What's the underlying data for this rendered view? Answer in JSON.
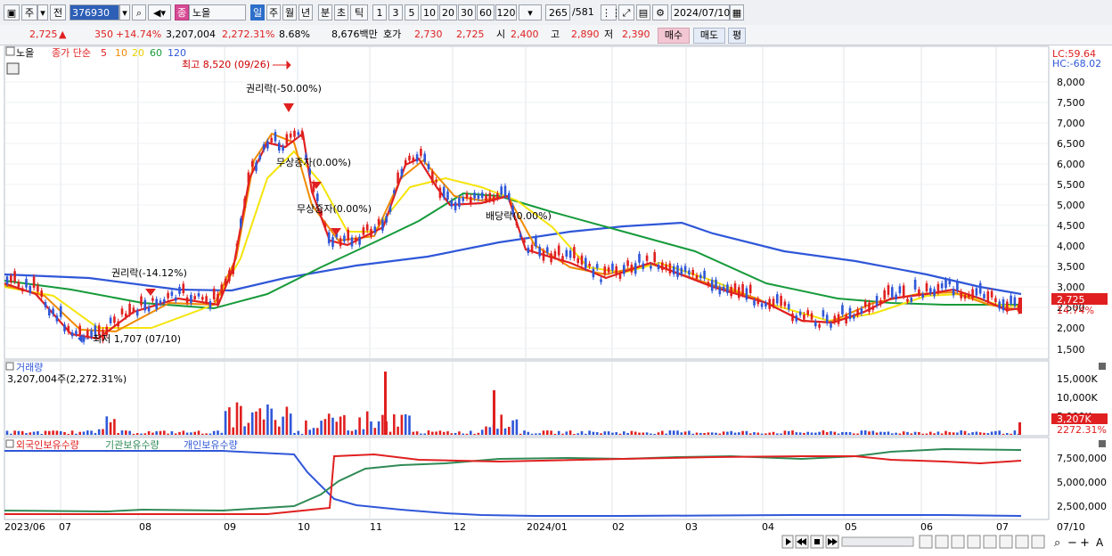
{
  "toolbar": {
    "type1": "주",
    "type2": "전",
    "code": "376930",
    "stock_name": "노을",
    "period_tabs": [
      "일",
      "주",
      "월",
      "년",
      "분",
      "초",
      "틱"
    ],
    "selected_period": "일",
    "minute_buttons": [
      "1",
      "3",
      "5",
      "10",
      "20",
      "30",
      "60",
      "120"
    ],
    "count_current": "265",
    "count_total": "/581",
    "date": "2024/07/10"
  },
  "info": {
    "price": "2,725",
    "change": "350",
    "change_pct": "+14.74%",
    "volume": "3,207,004",
    "volume_ratio": "2,272.31%",
    "turnover": "8.68%",
    "amount": "8,676백만",
    "ask_label": "호가",
    "ask1": "2,730",
    "ask2": "2,725",
    "open_label": "시",
    "open": "2,400",
    "high_label": "고",
    "high": "2,890",
    "low_label": "저",
    "low": "2,390",
    "buy_label": "매수",
    "sell_label": "매도",
    "avg_label": "평"
  },
  "price_panel": {
    "title": "노을",
    "legend_prefix": "종가 단순",
    "ma_labels": [
      "5",
      "10",
      "20",
      "60",
      "120"
    ],
    "ma_colors": [
      "#e02020",
      "#f08a00",
      "#f5e40a",
      "#169a3a",
      "#2f57d8"
    ],
    "lc": "LC:59.64",
    "hc": "HC:-68.02",
    "y_ticks": [
      "8,000",
      "7,500",
      "7,000",
      "6,500",
      "6,000",
      "5,500",
      "5,000",
      "4,500",
      "4,000",
      "3,500",
      "3,000",
      "2,500",
      "2,000",
      "1,500"
    ],
    "last_price": "2,725",
    "last_pct": "14.74%",
    "annotations": [
      "최고 8,520 (09/26)",
      "권리락(-50.00%)",
      "무상증자(0.00%)",
      "무상증자(0.00%)",
      "배당락(0.00%)",
      "권리락(-14.12%)",
      "최저 1,707 (07/10)"
    ]
  },
  "volume_panel": {
    "title": "거래량",
    "value": "3,207,004주(2,272.31%)",
    "y_ticks": [
      "15,000K",
      "10,000K",
      "5,000K"
    ],
    "last_value": "3,207K",
    "last_pct": "2272.31%"
  },
  "holding_panel": {
    "legend": [
      "외국인보유수량",
      "기관보유수량",
      "개인보유수량"
    ],
    "legend_colors": [
      "#e02020",
      "#2f8a55",
      "#2f57d8"
    ],
    "y_ticks": [
      "7,500,000",
      "5,000,000",
      "2,500,000"
    ]
  },
  "x_axis": {
    "labels": [
      "2023/06",
      "07",
      "08",
      "09",
      "10",
      "11",
      "12",
      "2024/01",
      "02",
      "03",
      "04",
      "05",
      "06",
      "07"
    ],
    "right_label": "07/10"
  }
}
